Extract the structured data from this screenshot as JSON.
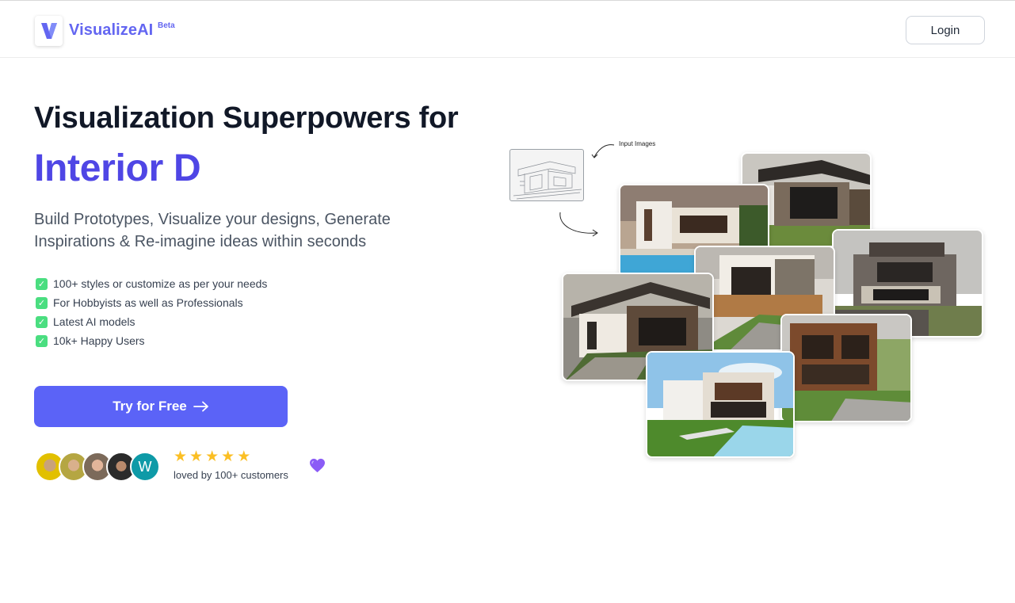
{
  "header": {
    "brand": "VisualizeAI",
    "badge": "Beta",
    "login_label": "Login"
  },
  "hero": {
    "title": "Visualization Superpowers for",
    "typed": "Interior D",
    "subtitle": "Build Prototypes, Visualize your designs, Generate Inspirations & Re-imagine ideas within seconds",
    "features": [
      "100+ styles or customize as per your needs",
      "For Hobbyists as well as Professionals",
      "Latest AI models",
      "10k+ Happy Users"
    ],
    "cta_label": "Try for Free",
    "rating_stars": 5,
    "loved_text": "loved by 100+ customers",
    "avatar_initial": "W"
  },
  "gallery": {
    "input_label": "Input Images"
  },
  "colors": {
    "accent": "#6366f1",
    "cta": "#5b63f7",
    "check": "#4ade80",
    "star": "#fbbf24",
    "heart": "#8b5cf6"
  },
  "icons": [
    "logo-v-icon",
    "check-icon",
    "arrow-right-icon",
    "star-icon",
    "purple-heart-icon",
    "curved-arrow-icon"
  ]
}
